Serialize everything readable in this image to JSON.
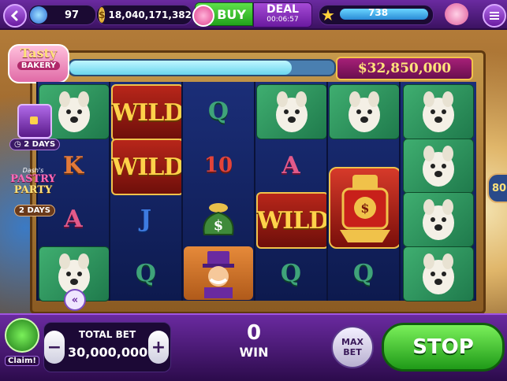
{
  "topbar": {
    "level": "97",
    "coins": "18,040,171,382",
    "buy_label": "BUY",
    "deal_label": "DEAL",
    "deal_timer": "00:06:57",
    "stars": "738"
  },
  "game": {
    "logo_line1": "Tasty",
    "logo_line2": "BAKERY",
    "jackpot": "$32,850,000",
    "progress": 0.84,
    "chest_days": "2 DAYS",
    "event_line1": "Dash's",
    "event_line2": "PASTRY",
    "event_line3": "PARTY",
    "event_days": "2 DAYS",
    "right_number": "80",
    "wild_label": "WILD",
    "letter_q": "Q",
    "letter_k": "K",
    "letter_a": "A",
    "letter_j": "J",
    "letter_10": "10"
  },
  "bottombar": {
    "claim_label": "Claim!",
    "total_bet_label": "TOTAL BET",
    "total_bet_value": "30,000,000",
    "minus": "−",
    "plus": "+",
    "win_value": "0",
    "win_label": "WIN",
    "max_bet_line1": "MAX",
    "max_bet_line2": "BET",
    "stop_label": "STOP"
  },
  "colors": {
    "accent_purple": "#6a2aa0",
    "green": "#22a31c",
    "jackpot_gold": "#ffe27a"
  }
}
